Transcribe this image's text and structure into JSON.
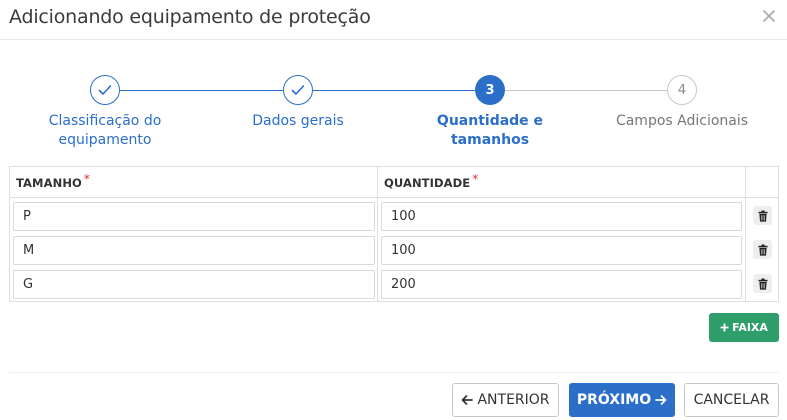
{
  "modal": {
    "title": "Adicionando equipamento de proteção"
  },
  "stepper": {
    "steps": [
      {
        "number": "1",
        "label_line1": "Classificação do",
        "label_line2": "equipamento",
        "status": "done"
      },
      {
        "number": "2",
        "label_line1": "Dados gerais",
        "label_line2": "",
        "status": "done"
      },
      {
        "number": "3",
        "label_line1": "Quantidade e tamanhos",
        "label_line2": "",
        "status": "active"
      },
      {
        "number": "4",
        "label_line1": "Campos Adicionais",
        "label_line2": "",
        "status": "todo"
      }
    ]
  },
  "grid": {
    "columns": [
      {
        "label": "TAMANHO",
        "required_mark": "*"
      },
      {
        "label": "QUANTIDADE",
        "required_mark": "*"
      }
    ],
    "rows": [
      {
        "tamanho": "P",
        "quantidade": "100"
      },
      {
        "tamanho": "M",
        "quantidade": "100"
      },
      {
        "tamanho": "G",
        "quantidade": "200"
      }
    ]
  },
  "actions": {
    "add_faixa_label": "FAIXA",
    "previous_label": "ANTERIOR",
    "next_label": "PRÓXIMO",
    "cancel_label": "CANCELAR"
  },
  "colors": {
    "primary": "#2b6fc9",
    "success": "#2e9e6b",
    "required": "#d33333",
    "inactive": "#c9c9c9"
  },
  "icons": {
    "close": "close-icon",
    "check": "check-icon",
    "trash": "trash-icon",
    "plus": "plus-icon",
    "arrow_left": "arrow-left-icon",
    "arrow_right": "arrow-right-icon"
  }
}
